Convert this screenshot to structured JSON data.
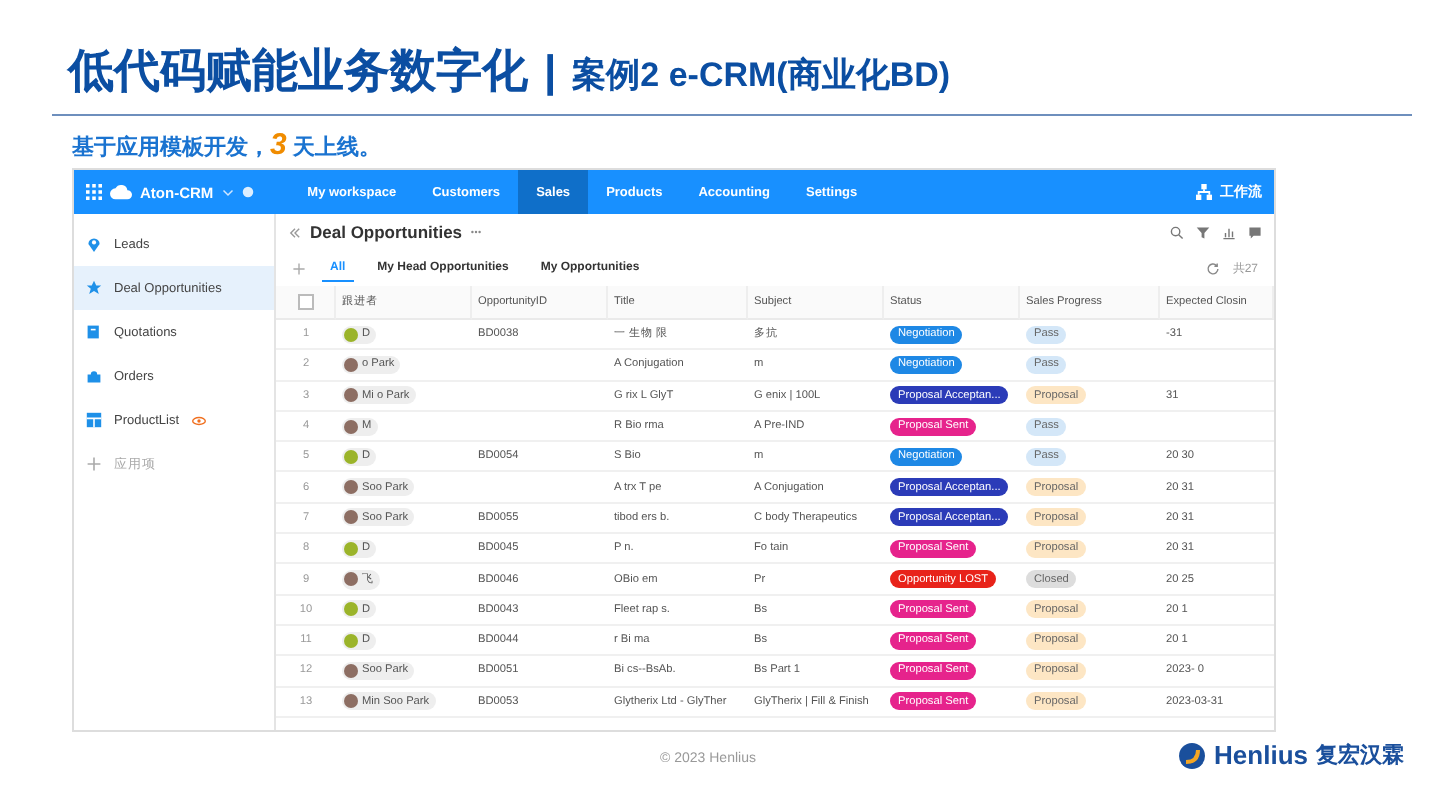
{
  "slide": {
    "title": "低代码赋能业务数字化",
    "title_separator": "|",
    "subtitle": "案例2 e-CRM(商业化BD)",
    "lead_before": "基于应用模板开发，",
    "lead_number": "3",
    "lead_after": "天上线。",
    "footer": "© 2023 Henlius",
    "logo_text": "Henlius",
    "logo_cn": "复宏汉霖"
  },
  "app": {
    "brand": "Aton-CRM",
    "nav": [
      {
        "label": "My workspace",
        "selected": false
      },
      {
        "label": "Customers",
        "selected": false
      },
      {
        "label": "Sales",
        "selected": true
      },
      {
        "label": "Products",
        "selected": false
      },
      {
        "label": "Accounting",
        "selected": false
      },
      {
        "label": "Settings",
        "selected": false
      }
    ],
    "workflow": "工作流",
    "sidebar": [
      {
        "label": "Leads",
        "kind": "pin",
        "selected": false
      },
      {
        "label": "Deal Opportunities",
        "kind": "star",
        "selected": true
      },
      {
        "label": "Quotations",
        "kind": "doc",
        "selected": false
      },
      {
        "label": "Orders",
        "kind": "bag",
        "selected": false
      },
      {
        "label": "ProductList",
        "kind": "grid",
        "selected": false
      },
      {
        "label": "应用项",
        "kind": "add",
        "selected": false
      }
    ],
    "page_title": "Deal Opportunities",
    "views": [
      {
        "label": "All",
        "selected": true
      },
      {
        "label": "My Head Opportunities",
        "selected": false
      },
      {
        "label": "My Opportunities",
        "selected": false
      }
    ],
    "total": "共27",
    "select_all": {
      "checked": false
    },
    "columns": [
      "跟进者",
      "OpportunityID",
      "Title",
      "Subject",
      "Status",
      "Sales Progress",
      "Expected Closin"
    ],
    "rows": [
      {
        "no": "1",
        "owner": "D",
        "color": "#9bb42a",
        "id": "BD0038",
        "title": "一 生物 限",
        "subject": "多抗",
        "status": {
          "text": "Negotiation",
          "color": "#1e88e5"
        },
        "progress": {
          "text": "Pass",
          "color": "#d4e7f8"
        },
        "date": "-31"
      },
      {
        "no": "2",
        "owner": "o Park",
        "color": "#8d6e63",
        "id": "",
        "title": "A Conjugation",
        "subject": "m",
        "status": {
          "text": "Negotiation",
          "color": "#1e88e5"
        },
        "progress": {
          "text": "Pass",
          "color": "#d4e7f8"
        },
        "date": ""
      },
      {
        "no": "3",
        "owner": "Mi o Park",
        "color": "#8d6e63",
        "id": "",
        "title": "G rix L GlyT",
        "subject": "G enix | 100L",
        "status": {
          "text": "Proposal Acceptan...",
          "color": "#2b3bb8"
        },
        "progress": {
          "text": "Proposal",
          "color": "#fde6c4"
        },
        "date": "31"
      },
      {
        "no": "4",
        "owner": "M",
        "color": "#8d6e63",
        "id": "",
        "title": "R Bio rma",
        "subject": "A Pre-IND",
        "status": {
          "text": "Proposal Sent",
          "color": "#e6238c"
        },
        "progress": {
          "text": "Pass",
          "color": "#d4e7f8"
        },
        "date": ""
      },
      {
        "no": "5",
        "owner": "D",
        "color": "#9bb42a",
        "id": "BD0054",
        "title": "S Bio",
        "subject": "m",
        "status": {
          "text": "Negotiation",
          "color": "#1e88e5"
        },
        "progress": {
          "text": "Pass",
          "color": "#d4e7f8"
        },
        "date": "20 30"
      },
      {
        "no": "6",
        "owner": "Soo Park",
        "color": "#8d6e63",
        "id": "",
        "title": "A trx T pe",
        "subject": "A Conjugation",
        "status": {
          "text": "Proposal Acceptan...",
          "color": "#2b3bb8"
        },
        "progress": {
          "text": "Proposal",
          "color": "#fde6c4"
        },
        "date": "20 31"
      },
      {
        "no": "7",
        "owner": "Soo Park",
        "color": "#8d6e63",
        "id": "BD0055",
        "title": "tibod ers b.",
        "subject": "C body Therapeutics",
        "status": {
          "text": "Proposal Acceptan...",
          "color": "#2b3bb8"
        },
        "progress": {
          "text": "Proposal",
          "color": "#fde6c4"
        },
        "date": "20 31"
      },
      {
        "no": "8",
        "owner": "D",
        "color": "#9bb42a",
        "id": "BD0045",
        "title": "P n.",
        "subject": "Fo tain",
        "status": {
          "text": "Proposal Sent",
          "color": "#e6238c"
        },
        "progress": {
          "text": "Proposal",
          "color": "#fde6c4"
        },
        "date": "20 31"
      },
      {
        "no": "9",
        "owner": "飞",
        "color": "#8d6e63",
        "id": "BD0046",
        "title": "OBio em",
        "subject": "Pr",
        "status": {
          "text": "Opportunity LOST",
          "color": "#e8231a"
        },
        "progress": {
          "text": "Closed",
          "color": "#dddddd"
        },
        "date": "20 25"
      },
      {
        "no": "10",
        "owner": "D",
        "color": "#9bb42a",
        "id": "BD0043",
        "title": "Fleet rap s.",
        "subject": "Bs",
        "status": {
          "text": "Proposal Sent",
          "color": "#e6238c"
        },
        "progress": {
          "text": "Proposal",
          "color": "#fde6c4"
        },
        "date": "20 1"
      },
      {
        "no": "11",
        "owner": "D",
        "color": "#9bb42a",
        "id": "BD0044",
        "title": "r Bi ma",
        "subject": "Bs",
        "status": {
          "text": "Proposal Sent",
          "color": "#e6238c"
        },
        "progress": {
          "text": "Proposal",
          "color": "#fde6c4"
        },
        "date": "20 1"
      },
      {
        "no": "12",
        "owner": "Soo Park",
        "color": "#8d6e63",
        "id": "BD0051",
        "title": "Bi cs--BsAb.",
        "subject": "Bs Part 1",
        "status": {
          "text": "Proposal Sent",
          "color": "#e6238c"
        },
        "progress": {
          "text": "Proposal",
          "color": "#fde6c4"
        },
        "date": "2023- 0"
      },
      {
        "no": "13",
        "owner": "Min Soo Park",
        "color": "#8d6e63",
        "id": "BD0053",
        "title": "Glytherix Ltd - GlyTher",
        "subject": "GlyTherix | Fill & Finish",
        "status": {
          "text": "Proposal Sent",
          "color": "#e6238c"
        },
        "progress": {
          "text": "Proposal",
          "color": "#fde6c4"
        },
        "date": "2023-03-31"
      }
    ]
  }
}
